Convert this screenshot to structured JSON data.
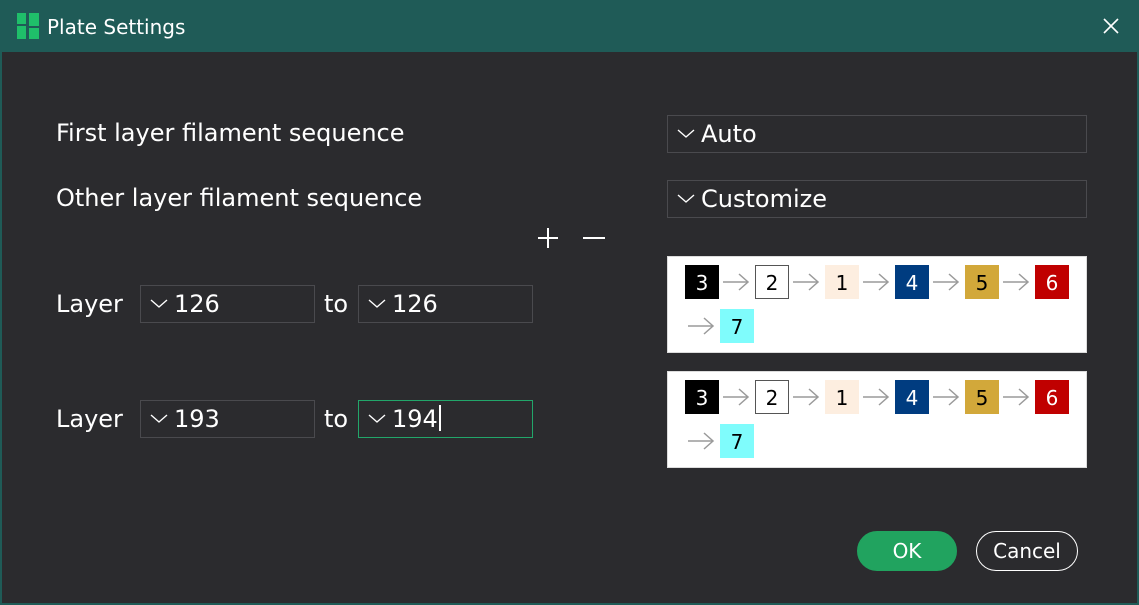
{
  "window": {
    "title": "Plate Settings",
    "icon": "app-logo-icon",
    "close_icon": "close-icon"
  },
  "settings": {
    "first_layer": {
      "label": "First layer filament sequence",
      "value": "Auto"
    },
    "other_layer": {
      "label": "Other layer filament sequence",
      "value": "Customize"
    }
  },
  "range_controls": {
    "add_icon": "plus-icon",
    "remove_icon": "minus-icon"
  },
  "ranges": [
    {
      "label": "Layer",
      "from": "126",
      "to_label": "to",
      "to": "126",
      "sequence": [
        {
          "num": "3",
          "bg": "#000000",
          "fg": "#ffffff",
          "border": "#000000"
        },
        {
          "num": "2",
          "bg": "#ffffff",
          "fg": "#000000",
          "border": "#555555"
        },
        {
          "num": "1",
          "bg": "#fdeee0",
          "fg": "#000000",
          "border": "#fdeee0"
        },
        {
          "num": "4",
          "bg": "#003c80",
          "fg": "#ffffff",
          "border": "#003c80"
        },
        {
          "num": "5",
          "bg": "#d2a83a",
          "fg": "#000000",
          "border": "#d2a83a"
        },
        {
          "num": "6",
          "bg": "#c00000",
          "fg": "#ffffff",
          "border": "#c00000"
        },
        {
          "num": "7",
          "bg": "#7ffcfc",
          "fg": "#000000",
          "border": "#7ffcfc"
        }
      ]
    },
    {
      "label": "Layer",
      "from": "193",
      "to_label": "to",
      "to": "194",
      "sequence": [
        {
          "num": "3",
          "bg": "#000000",
          "fg": "#ffffff",
          "border": "#000000"
        },
        {
          "num": "2",
          "bg": "#ffffff",
          "fg": "#000000",
          "border": "#555555"
        },
        {
          "num": "1",
          "bg": "#fdeee0",
          "fg": "#000000",
          "border": "#fdeee0"
        },
        {
          "num": "4",
          "bg": "#003c80",
          "fg": "#ffffff",
          "border": "#003c80"
        },
        {
          "num": "5",
          "bg": "#d2a83a",
          "fg": "#000000",
          "border": "#d2a83a"
        },
        {
          "num": "6",
          "bg": "#c00000",
          "fg": "#ffffff",
          "border": "#c00000"
        },
        {
          "num": "7",
          "bg": "#7ffcfc",
          "fg": "#000000",
          "border": "#7ffcfc"
        }
      ]
    }
  ],
  "footer": {
    "ok_label": "OK",
    "cancel_label": "Cancel"
  },
  "colors": {
    "titlebar": "#1f5b57",
    "background": "#2b2b2e",
    "accent": "#21a35f",
    "focus_border": "#22a66a"
  }
}
